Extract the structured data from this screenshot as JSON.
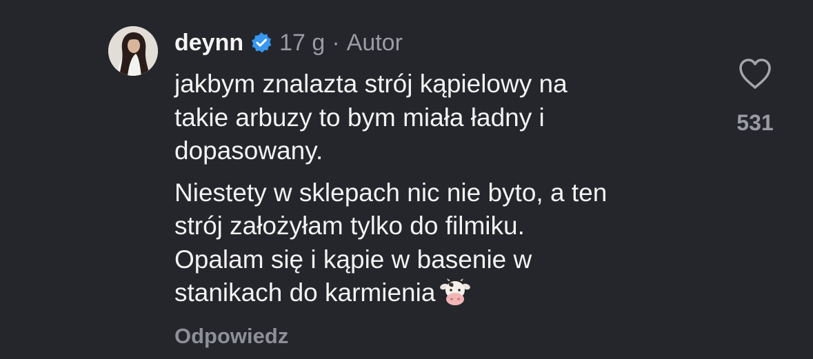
{
  "comment": {
    "username": "deynn",
    "verified": true,
    "time": "17 g",
    "separator": "·",
    "author_tag": "Autor",
    "paragraph_1": "jakbym znalazta strój kąpielowy na\ntakie arbuzy to bym miała ładny i\ndopasowany.",
    "paragraph_2": "Niestety w sklepach nic nie byto, a ten\nstrój założyłam tylko do filmiku.\nOpalam się i kąpie w basenie w\nstanikach do karmienia",
    "emoji": "cow-face",
    "reply_label": "Odpowiedz",
    "like_count": "531"
  },
  "icons": {
    "verified": "verified-badge-icon",
    "like": "heart-outline-icon"
  },
  "colors": {
    "background": "#25262b",
    "text": "#f3f3f3",
    "muted": "#9a9ca3",
    "verified_blue": "#3897f0"
  }
}
